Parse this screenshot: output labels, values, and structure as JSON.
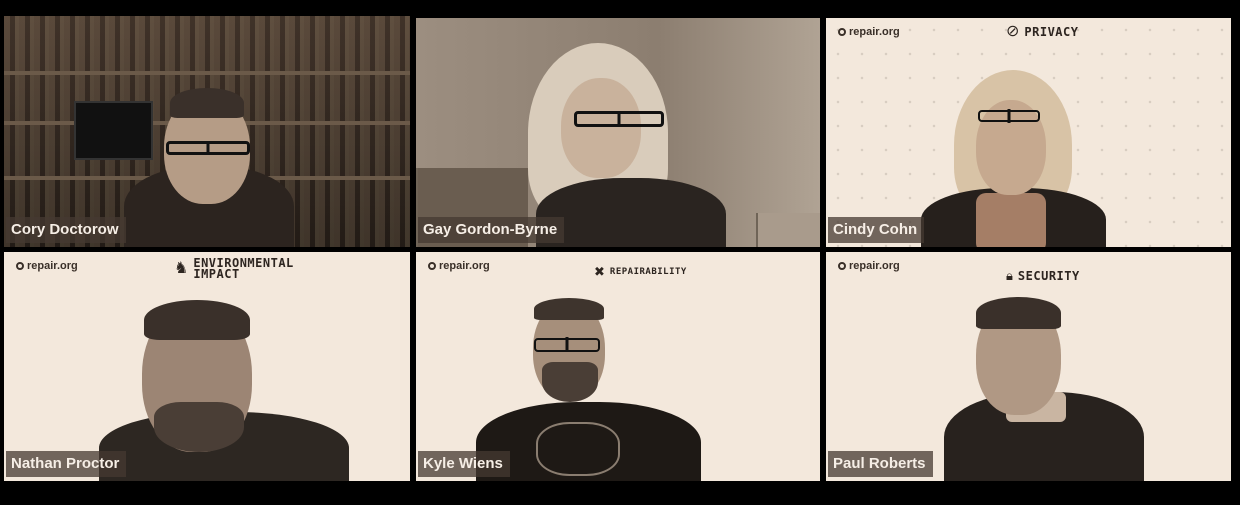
{
  "participants": [
    {
      "name": "Cory Doctorow"
    },
    {
      "name": "Gay Gordon-Byrne"
    },
    {
      "name": "Cindy Cohn",
      "brand": "repair.org",
      "topic": "PRIVACY"
    },
    {
      "name": "Nathan Proctor",
      "brand": "repair.org",
      "topic_line1": "ENVIRONMENTAL",
      "topic_line2": "IMPACT"
    },
    {
      "name": "Kyle Wiens",
      "brand": "repair.org",
      "topic": "REPAIRABILITY"
    },
    {
      "name": "Paul Roberts",
      "brand": "repair.org",
      "topic": "SECURITY"
    }
  ],
  "colors": {
    "tile_bg": "#f3e8dc",
    "name_tag_bg": "#463a32",
    "active_speaker_border": "#7a6f62"
  },
  "icons": {
    "privacy": "eye-slash-icon",
    "environment": "rocking-horse-icon",
    "repairability": "wrench-screwdriver-icon",
    "security": "lock-icon",
    "brand": "repair-org-logo-icon"
  }
}
